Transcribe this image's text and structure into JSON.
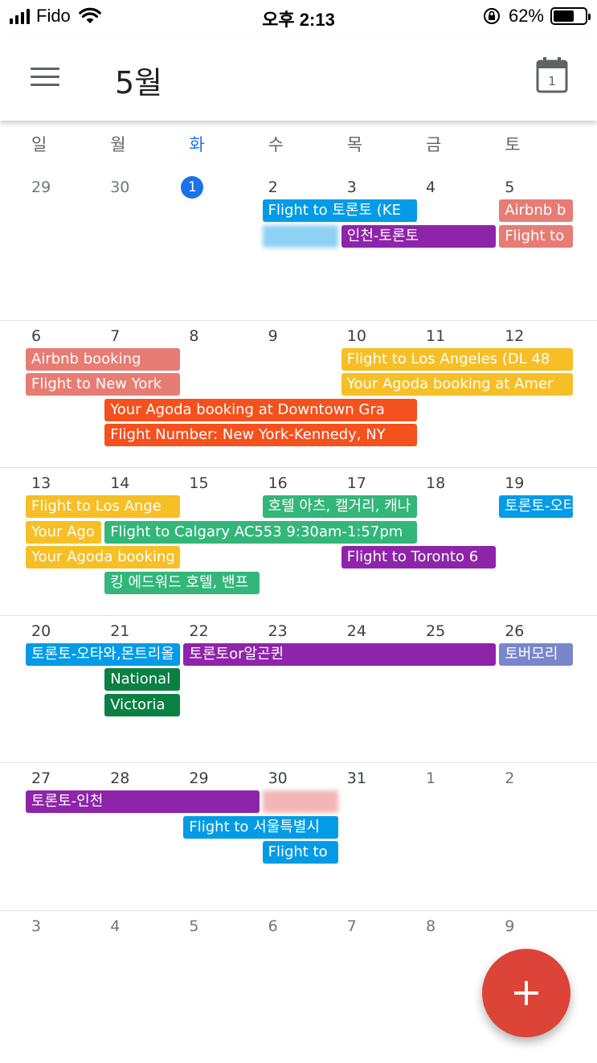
{
  "status_bar": {
    "carrier": "Fido",
    "time": "오후 2:13",
    "battery": "62%",
    "battery_level": 0.62,
    "icons": [
      "signal-icon",
      "wifi-icon",
      "orientation-lock-icon",
      "battery-icon"
    ]
  },
  "app_bar": {
    "title": "5월",
    "menu_icon": "hamburger-menu-icon",
    "today_icon": "calendar-today-icon",
    "today_number": "1"
  },
  "weekdays": [
    "일",
    "월",
    "화",
    "수",
    "목",
    "금",
    "토"
  ],
  "today_weekday_index": 2,
  "colors": {
    "today_blue": "#1a73e8",
    "blue": "#039be5",
    "purple": "#8e24aa",
    "red_pink": "#e67c73",
    "orange": "#f4511e",
    "yellow": "#f6bf26",
    "green": "#33b679",
    "teal": "#0b8043",
    "lavender": "#7986cb",
    "fab_red": "#db4437"
  },
  "weeks": [
    {
      "days": [
        "29",
        "30",
        "1",
        "2",
        "3",
        "4",
        "5"
      ],
      "other_month": [
        0,
        1
      ],
      "today_index": 2,
      "events": [
        {
          "label": "Flight to 토론토 (KE",
          "start": 3,
          "span": 2,
          "row": 0,
          "color": "#039be5"
        },
        {
          "label": "",
          "start": 3,
          "span": 1,
          "row": 1,
          "color": "#8fd0f3",
          "blurred": true
        },
        {
          "label": "인천-토론토",
          "start": 4,
          "span": 2,
          "row": 1,
          "color": "#8e24aa"
        },
        {
          "label": "Airbnb b",
          "start": 6,
          "span": 1,
          "row": 0,
          "color": "#e67c73"
        },
        {
          "label": "Flight to",
          "start": 6,
          "span": 1,
          "row": 1,
          "color": "#e67c73"
        }
      ]
    },
    {
      "days": [
        "6",
        "7",
        "8",
        "9",
        "10",
        "11",
        "12"
      ],
      "other_month": [],
      "events": [
        {
          "label": "Airbnb booking",
          "start": 0,
          "span": 2,
          "row": 0,
          "color": "#e67c73"
        },
        {
          "label": "Flight to New York",
          "start": 0,
          "span": 2,
          "row": 1,
          "color": "#e67c73"
        },
        {
          "label": "Flight to Los Angeles (DL 48",
          "start": 4,
          "span": 3,
          "row": 0,
          "color": "#f6bf26"
        },
        {
          "label": "Your Agoda booking at Amer",
          "start": 4,
          "span": 3,
          "row": 1,
          "color": "#f6bf26"
        },
        {
          "label": "Your Agoda booking at Downtown Gra",
          "start": 1,
          "span": 4,
          "row": 2,
          "color": "#f4511e"
        },
        {
          "label": "Flight Number: New York-Kennedy, NY",
          "start": 1,
          "span": 4,
          "row": 3,
          "color": "#f4511e"
        }
      ]
    },
    {
      "days": [
        "13",
        "14",
        "15",
        "16",
        "17",
        "18",
        "19"
      ],
      "other_month": [],
      "events": [
        {
          "label": "Flight to Los Ange",
          "start": 0,
          "span": 2,
          "row": 0,
          "color": "#f6bf26"
        },
        {
          "label": "호텔 아츠, 캘거리, 캐나",
          "start": 3,
          "span": 2,
          "row": 0,
          "color": "#33b679"
        },
        {
          "label": "토론토-오타",
          "start": 6,
          "span": 1,
          "row": 0,
          "color": "#039be5"
        },
        {
          "label": "Your Ago",
          "start": 0,
          "span": 1,
          "row": 1,
          "color": "#f6bf26"
        },
        {
          "label": "Flight to Calgary AC553 9:30am-1:57pm",
          "start": 1,
          "span": 4,
          "row": 1,
          "color": "#33b679"
        },
        {
          "label": "Your Agoda booking",
          "start": 0,
          "span": 2,
          "row": 2,
          "color": "#f6bf26"
        },
        {
          "label": "Flight to Toronto 6",
          "start": 4,
          "span": 2,
          "row": 2,
          "color": "#8e24aa"
        },
        {
          "label": "킹 에드워드 호텔, 밴프",
          "start": 1,
          "span": 2,
          "row": 3,
          "color": "#33b679"
        }
      ]
    },
    {
      "days": [
        "20",
        "21",
        "22",
        "23",
        "24",
        "25",
        "26"
      ],
      "other_month": [],
      "events": [
        {
          "label": "토론토-오타와,몬트리올",
          "start": 0,
          "span": 2,
          "row": 0,
          "color": "#039be5"
        },
        {
          "label": "토론토or알곤퀸",
          "start": 2,
          "span": 4,
          "row": 0,
          "color": "#8e24aa"
        },
        {
          "label": "토버모리",
          "start": 6,
          "span": 1,
          "row": 0,
          "color": "#7986cb"
        },
        {
          "label": "National",
          "start": 1,
          "span": 1,
          "row": 1,
          "color": "#0b8043"
        },
        {
          "label": "Victoria",
          "start": 1,
          "span": 1,
          "row": 2,
          "color": "#0b8043"
        }
      ]
    },
    {
      "days": [
        "27",
        "28",
        "29",
        "30",
        "31",
        "1",
        "2"
      ],
      "other_month": [
        5,
        6
      ],
      "events": [
        {
          "label": "토론토-인천",
          "start": 0,
          "span": 3,
          "row": 0,
          "color": "#8e24aa"
        },
        {
          "label": "",
          "start": 3,
          "span": 1,
          "row": 0,
          "color": "#f2b6b6",
          "blurred": true
        },
        {
          "label": "Flight to 서울특별시",
          "start": 2,
          "span": 2,
          "row": 1,
          "color": "#039be5"
        },
        {
          "label": "Flight to",
          "start": 3,
          "span": 1,
          "row": 2,
          "color": "#039be5"
        }
      ]
    },
    {
      "days": [
        "3",
        "4",
        "5",
        "6",
        "7",
        "8",
        "9"
      ],
      "other_month": [
        0,
        1,
        2,
        3,
        4,
        5,
        6
      ],
      "events": []
    }
  ],
  "fab": {
    "icon": "plus-icon"
  }
}
